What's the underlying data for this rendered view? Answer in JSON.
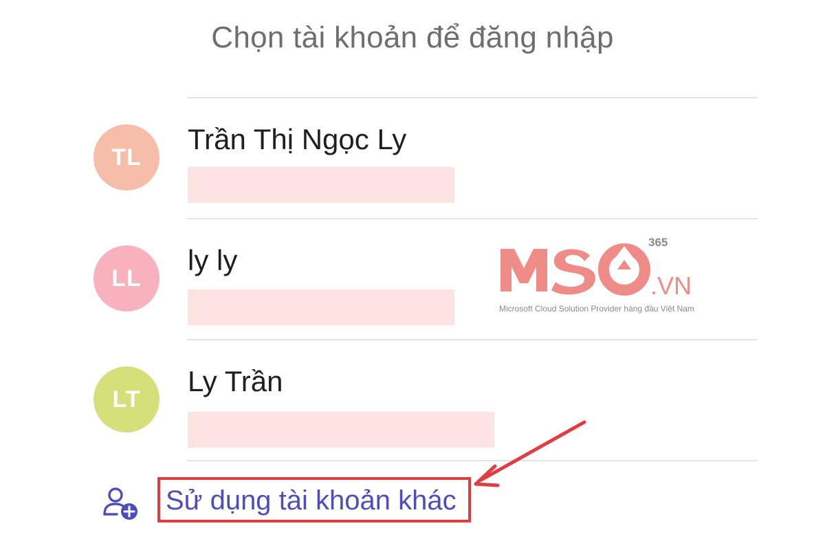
{
  "title": "Chọn tài khoản để đăng nhập",
  "accounts": [
    {
      "initials": "TL",
      "name": "Trần Thị Ngọc Ly",
      "avatar_color": "#f6bda9"
    },
    {
      "initials": "LL",
      "name": "ly ly",
      "avatar_color": "#f7b2bd"
    },
    {
      "initials": "LT",
      "name": "Ly Trần",
      "avatar_color": "#d6e07b"
    }
  ],
  "add_account": {
    "label": "Sử dụng tài khoản khác",
    "icon": "add-person-icon",
    "accent_color": "#4f4dbb",
    "highlight_color": "#e23b40"
  },
  "watermark": {
    "logo": "MSO",
    "superscript": "365",
    "suffix": ".VN",
    "tagline": "Microsoft Cloud Solution Provider hàng đầu Việt Nam"
  }
}
